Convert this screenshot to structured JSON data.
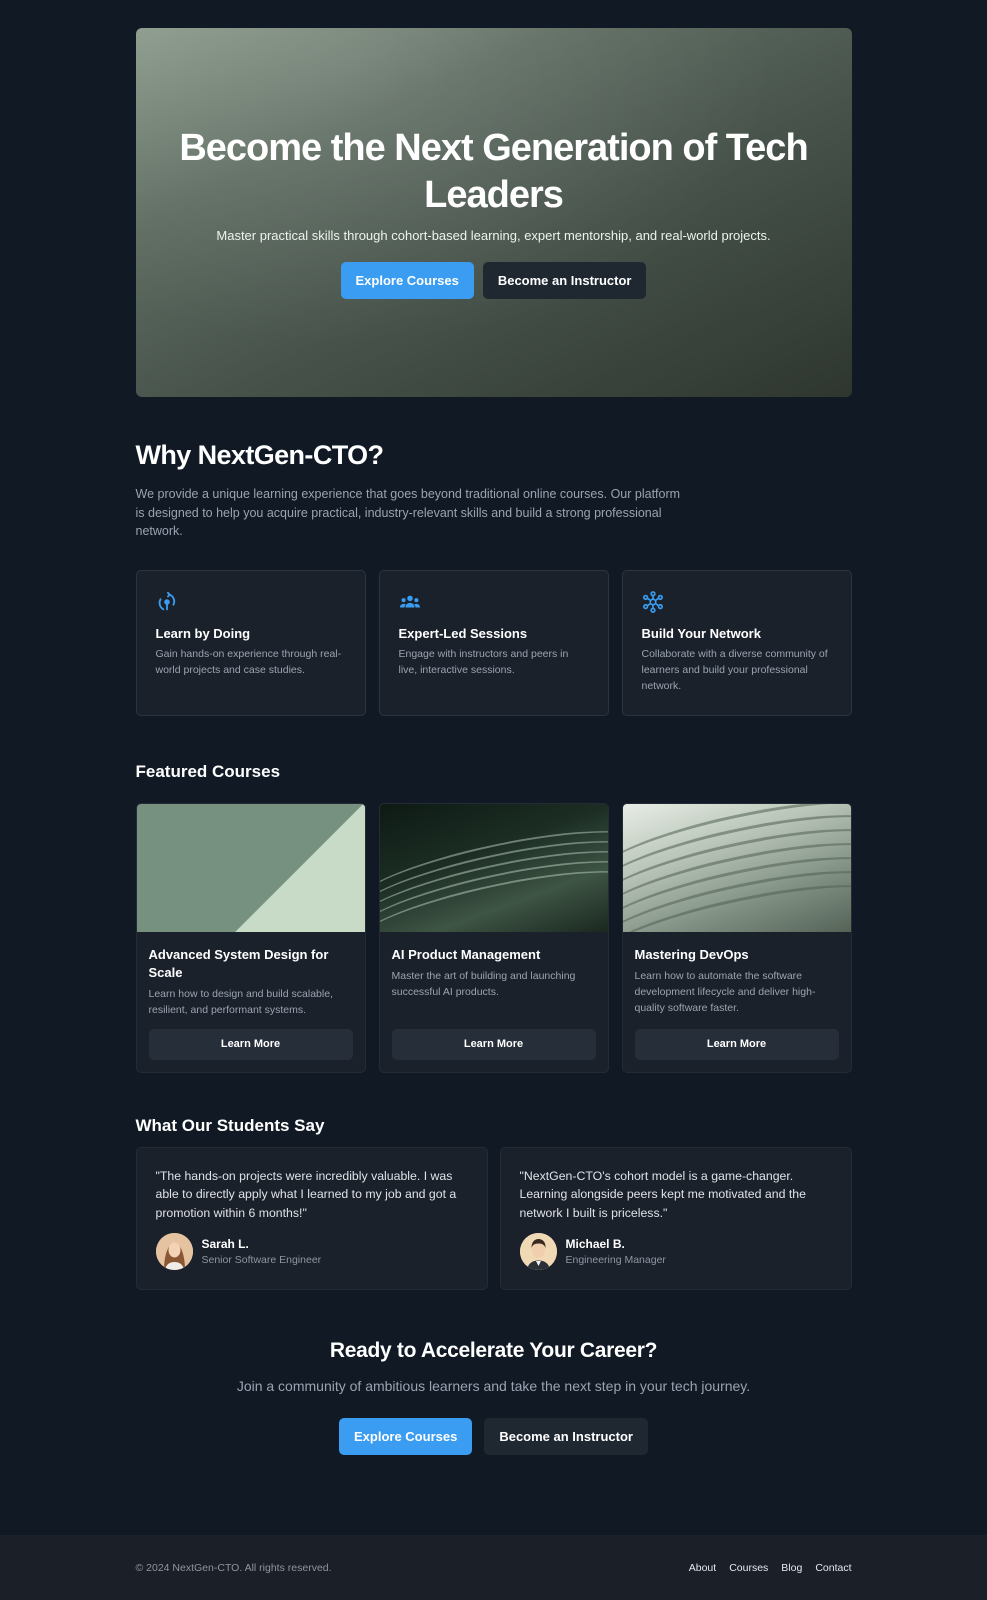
{
  "hero": {
    "title": "Become the Next Generation of Tech Leaders",
    "subtitle": "Master practical skills through cohort-based learning, expert mentorship, and real-world projects.",
    "primary_button": "Explore Courses",
    "secondary_button": "Become an Instructor"
  },
  "why": {
    "title": "Why NextGen-CTO?",
    "description": "We provide a unique learning experience that goes beyond traditional online courses. Our platform is designed to help you acquire practical, industry-relevant skills and build a strong professional network.",
    "features": [
      {
        "icon": "learn-by-doing-icon",
        "title": "Learn by Doing",
        "text": "Gain hands-on experience through real-world projects and case studies."
      },
      {
        "icon": "group-icon",
        "title": "Expert-Led Sessions",
        "text": "Engage with instructors and peers in live, interactive sessions."
      },
      {
        "icon": "network-icon",
        "title": "Build Your Network",
        "text": "Collaborate with a diverse community of learners and build your professional network."
      }
    ]
  },
  "courses": {
    "title": "Featured Courses",
    "items": [
      {
        "title": "Advanced System Design for Scale",
        "text": "Learn how to design and build scalable, resilient, and performant systems.",
        "button": "Learn More"
      },
      {
        "title": "AI Product Management",
        "text": "Master the art of building and launching successful AI products.",
        "button": "Learn More"
      },
      {
        "title": "Mastering DevOps",
        "text": "Learn how to automate the software development lifecycle and deliver high-quality software faster.",
        "button": "Learn More"
      }
    ]
  },
  "testimonials": {
    "title": "What Our Students Say",
    "items": [
      {
        "quote": "\"The hands-on projects were incredibly valuable. I was able to directly apply what I learned to my job and got a promotion within 6 months!\"",
        "name": "Sarah L.",
        "role": "Senior Software Engineer"
      },
      {
        "quote": "\"NextGen-CTO's cohort model is a game-changer. Learning alongside peers kept me motivated and the network I built is priceless.\"",
        "name": "Michael B.",
        "role": "Engineering Manager"
      }
    ]
  },
  "cta": {
    "title": "Ready to Accelerate Your Career?",
    "text": "Join a community of ambitious learners and take the next step in your tech journey.",
    "primary_button": "Explore Courses",
    "secondary_button": "Become an Instructor"
  },
  "footer": {
    "copyright": "© 2024 NextGen-CTO. All rights reserved.",
    "links": [
      "About",
      "Courses",
      "Blog",
      "Contact"
    ]
  },
  "colors": {
    "background": "#101924",
    "accent": "#3a9df2",
    "card": "#1b212b"
  }
}
